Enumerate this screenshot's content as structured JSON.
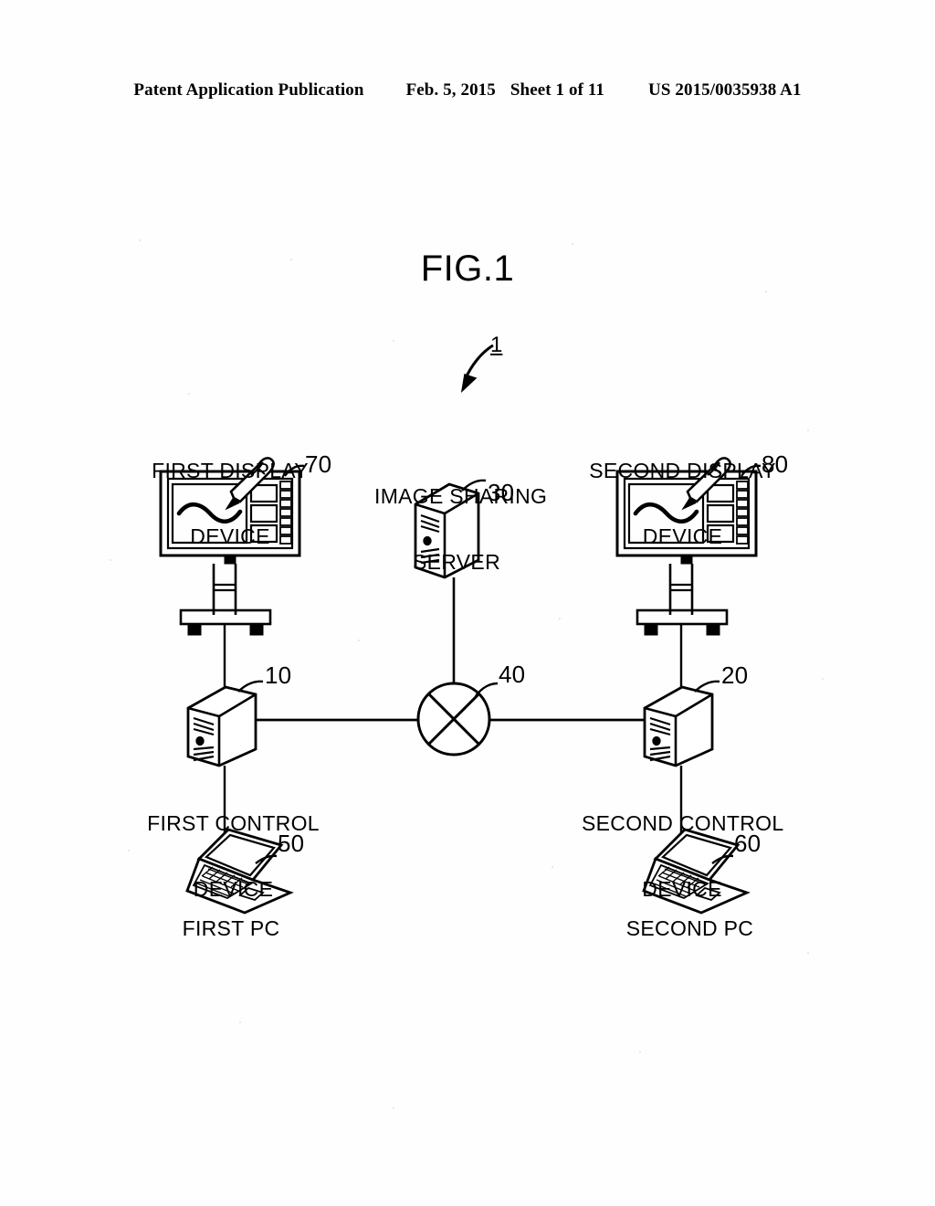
{
  "header": {
    "publication": "Patent Application Publication",
    "date": "Feb. 5, 2015",
    "sheet": "Sheet 1 of 11",
    "number": "US 2015/0035938 A1"
  },
  "figure": {
    "title": "FIG.1",
    "system_ref": "1",
    "nodes": {
      "first_display_device": {
        "label_line1": "FIRST DISPLAY",
        "label_line2": "DEVICE",
        "ref": "70"
      },
      "second_display_device": {
        "label_line1": "SECOND DISPLAY",
        "label_line2": "DEVICE",
        "ref": "80"
      },
      "image_sharing_server": {
        "label_line1": "IMAGE SHARING",
        "label_line2": "SERVER",
        "ref": "30"
      },
      "first_control_device": {
        "label_line1": "FIRST CONTROL",
        "label_line2": "DEVICE",
        "ref": "10"
      },
      "second_control_device": {
        "label_line1": "SECOND CONTROL",
        "label_line2": "DEVICE",
        "ref": "20"
      },
      "network": {
        "label": "",
        "ref": "40"
      },
      "first_pc": {
        "label": "FIRST PC",
        "ref": "50"
      },
      "second_pc": {
        "label": "SECOND PC",
        "ref": "60"
      }
    }
  },
  "colors": {
    "ink": "#000000",
    "paper": "#ffffff"
  }
}
